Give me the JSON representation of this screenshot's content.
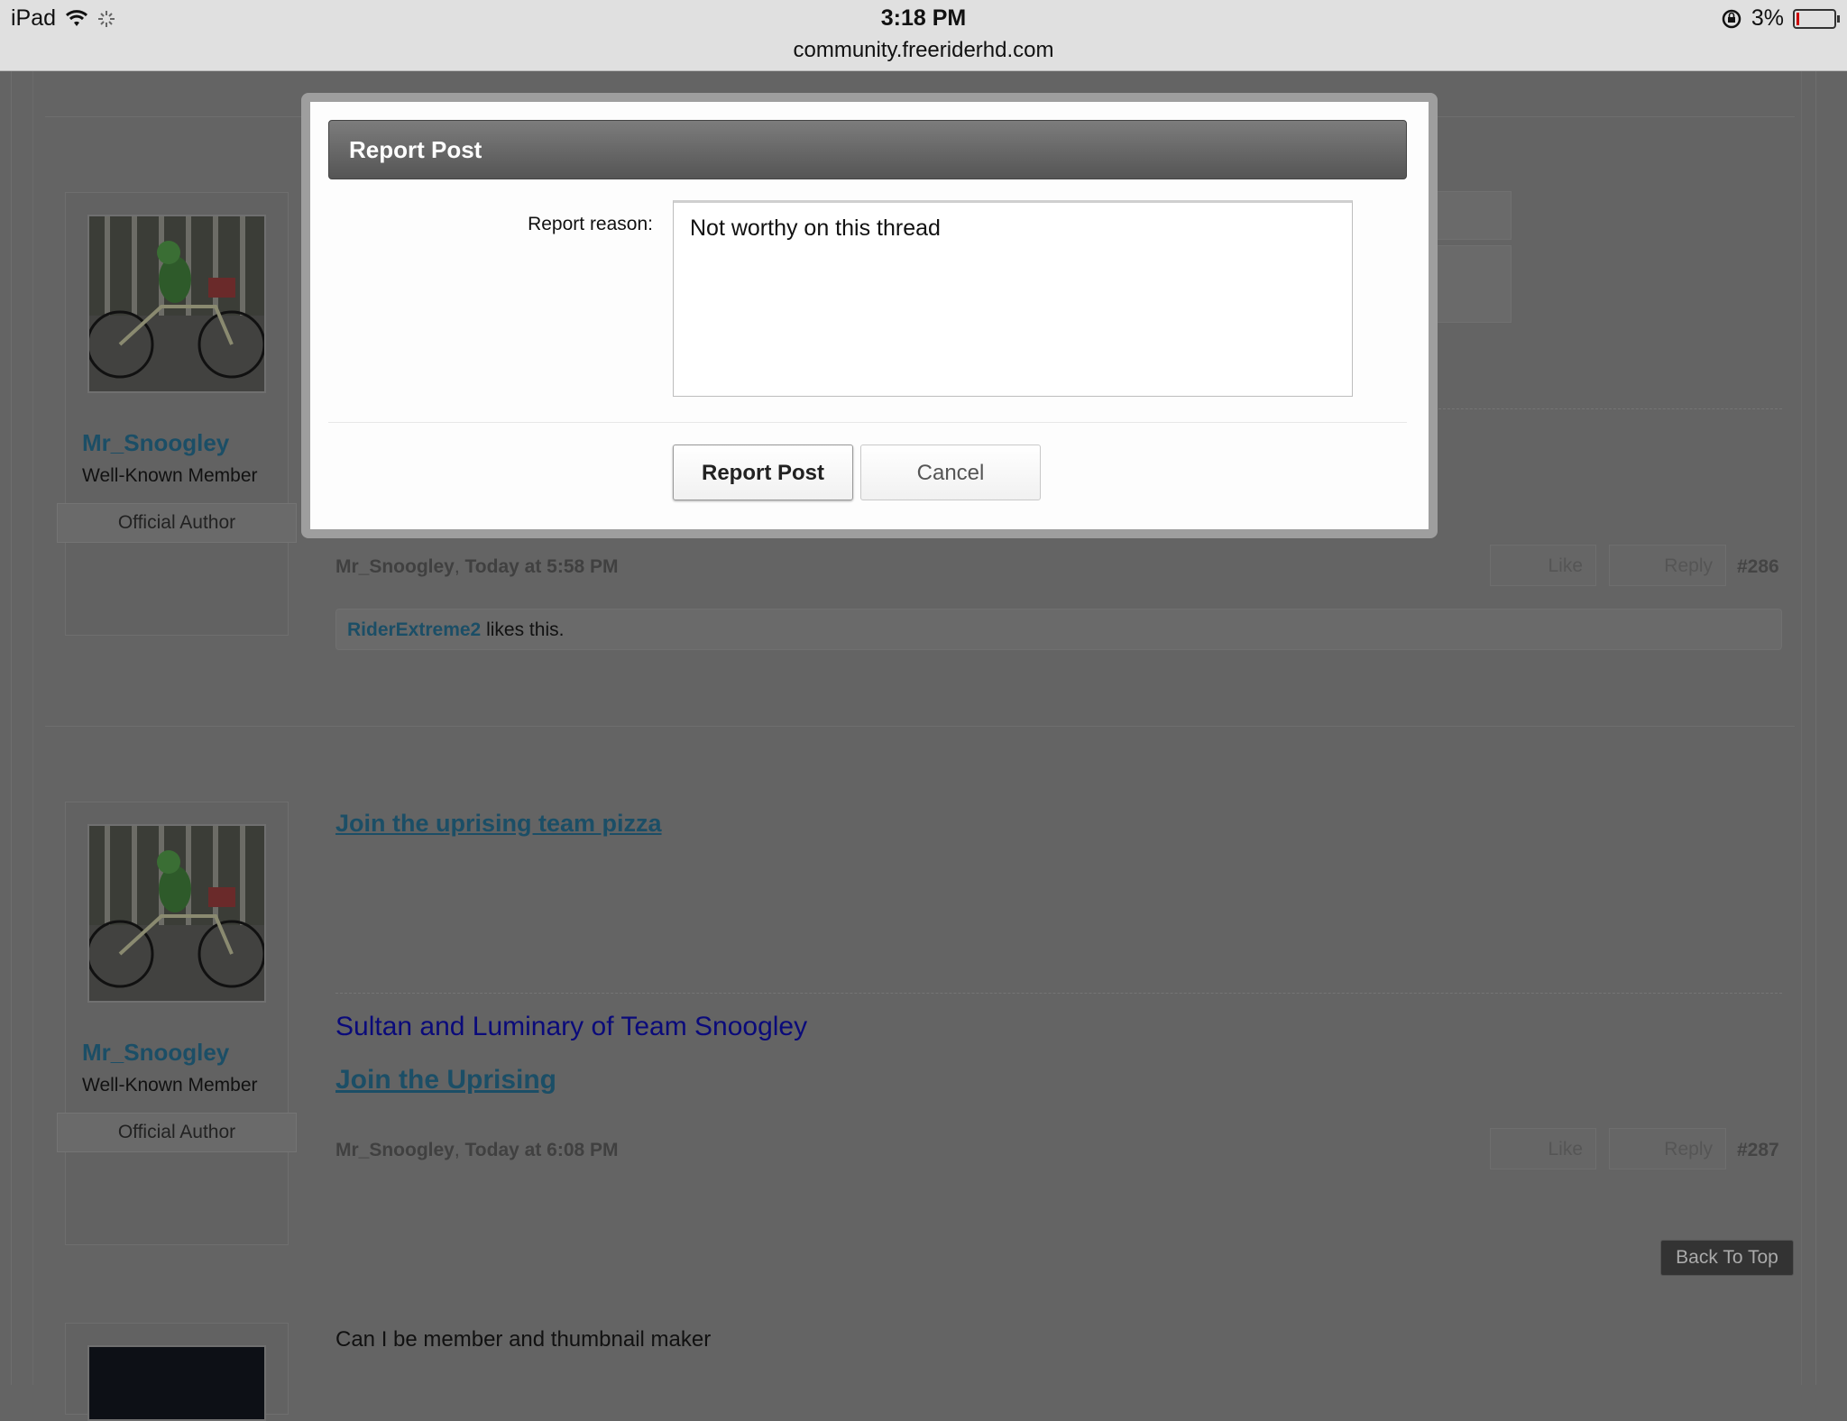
{
  "status_bar": {
    "device": "iPad",
    "time": "3:18 PM",
    "url": "community.freeriderhd.com",
    "battery": "3%"
  },
  "dialog": {
    "title": "Report Post",
    "reason_label": "Report reason:",
    "reason_value": "Not worthy on this thread",
    "submit_label": "Report Post",
    "cancel_label": "Cancel"
  },
  "posts": [
    {
      "username": "Mr_Snoogley",
      "role": "Well-Known Member",
      "badge": "Official Author",
      "author": "Mr_Snoogley",
      "time": "Today at 5:58 PM",
      "like_label": "Like",
      "reply_label": "Reply",
      "number": "#286",
      "likes_user": "RiderExtreme2",
      "likes_text": " likes this."
    },
    {
      "link_text": "Join the uprising team pizza",
      "username": "Mr_Snoogley",
      "role": "Well-Known Member",
      "badge": "Official Author",
      "signature_line": "Sultan and Luminary of Team Snoogley",
      "signature_link": "Join the Uprising",
      "author": "Mr_Snoogley",
      "time": "Today at 6:08 PM",
      "like_label": "Like",
      "reply_label": "Reply",
      "number": "#287"
    },
    {
      "text": "Can I be member and thumbnail maker"
    }
  ],
  "back_to_top": "Back To Top",
  "colors": {
    "overlay": "#646464",
    "link": "#1b4e66",
    "signature": "#0a0a7a",
    "dialog_header": "#6a6a6a"
  }
}
